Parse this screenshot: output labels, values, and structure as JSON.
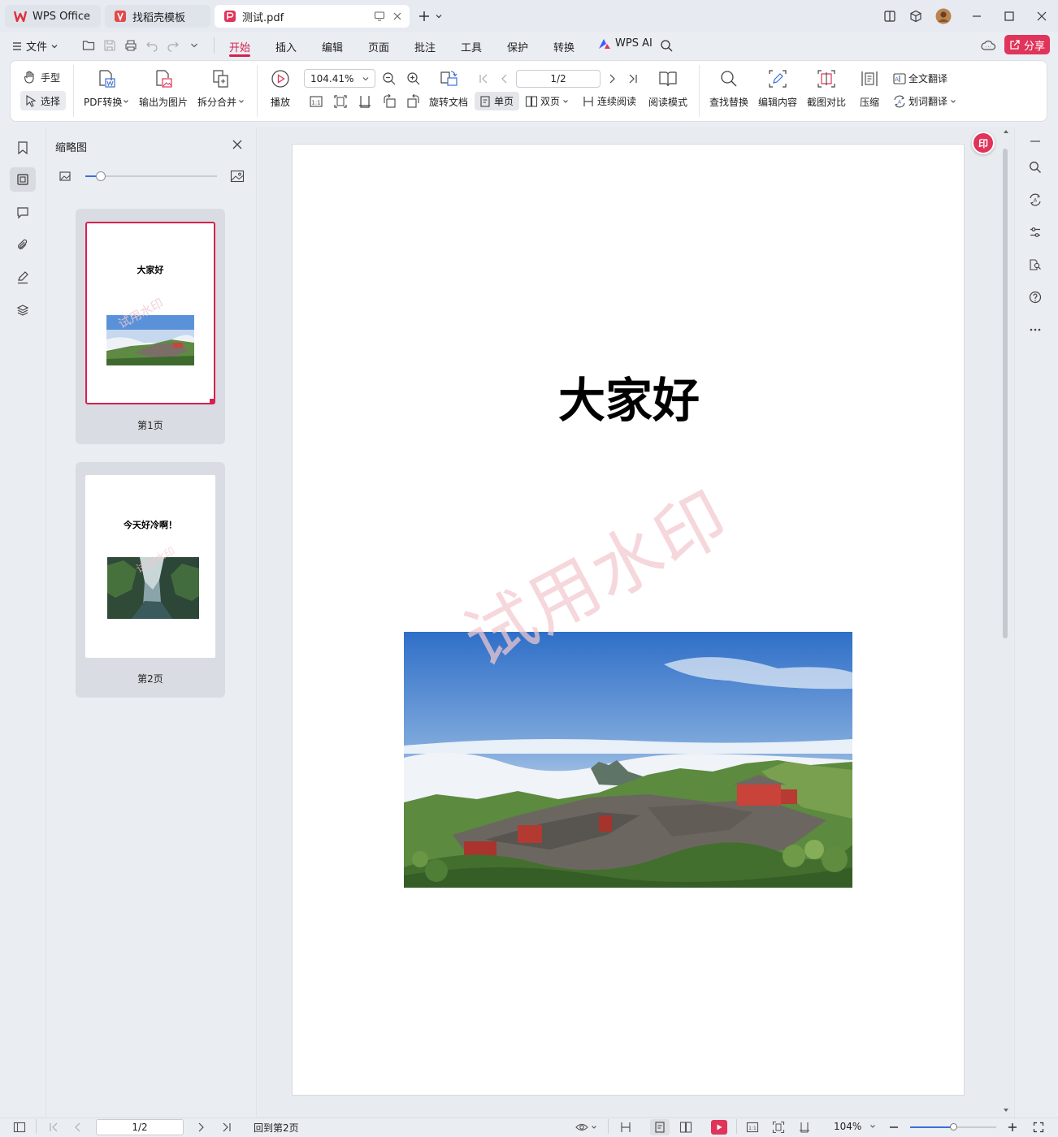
{
  "titlebar": {
    "tabs": [
      {
        "label": "WPS Office",
        "icon": "wps-logo-icon"
      },
      {
        "label": "找稻壳模板",
        "icon": "docer-icon"
      },
      {
        "label": "测试.pdf",
        "icon": "pdf-icon"
      }
    ]
  },
  "menubar": {
    "file_label": "文件",
    "tabs": [
      "开始",
      "插入",
      "编辑",
      "页面",
      "批注",
      "工具",
      "保护",
      "转换"
    ],
    "active_tab": "开始",
    "ai_label": "WPS AI",
    "share_label": "分享"
  },
  "ribbon": {
    "hand": "手型",
    "select": "选择",
    "pdf_convert": "PDF转换",
    "export_image": "输出为图片",
    "split_merge": "拆分合并",
    "play": "播放",
    "zoom_value": "104.41%",
    "rotate_doc": "旋转文档",
    "page_value": "1/2",
    "single_page": "单页",
    "double_page": "双页",
    "continuous": "连续阅读",
    "read_mode": "阅读模式",
    "find_replace": "查找替换",
    "edit_content": "编辑内容",
    "screenshot_compare": "截图对比",
    "compress": "压缩",
    "full_translate": "全文翻译",
    "word_translate": "划词翻译"
  },
  "thumbnails": {
    "title": "缩略图",
    "slider_level": 0.12,
    "pages": [
      {
        "label": "第1页",
        "heading": "大家好",
        "selected": true
      },
      {
        "label": "第2页",
        "heading": "今天好冷啊！",
        "selected": false
      }
    ]
  },
  "document": {
    "heading": "大家好",
    "watermark": "试用水印",
    "stamp_badge": "印"
  },
  "statusbar": {
    "page_value": "1/2",
    "back_to_page": "回到第2页",
    "zoom": "104%",
    "zoom_level": 0.5
  },
  "colors": {
    "accent": "#d6204e",
    "share_bg": "#e0345a",
    "watermark": "#f2c9cf"
  }
}
